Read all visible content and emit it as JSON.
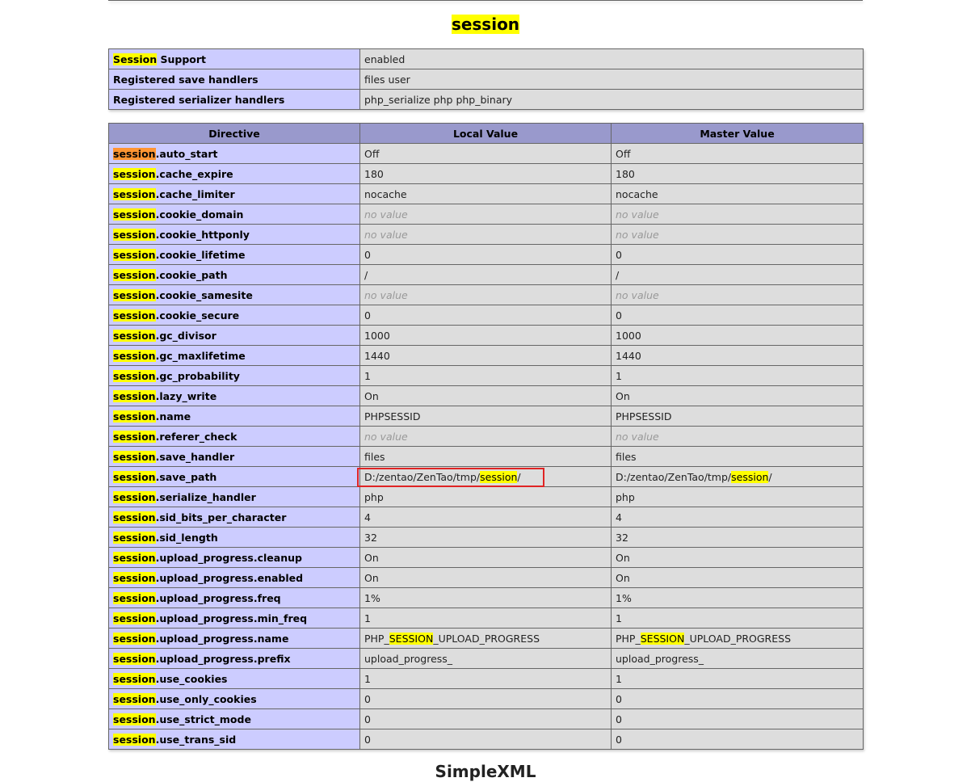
{
  "page": {
    "section_title": "session",
    "search_highlight": "session",
    "next_section_title": "SimpleXML"
  },
  "info_rows": [
    {
      "label_hl": "Session",
      "label_rest": " Support",
      "value": "enabled"
    },
    {
      "label_hl": "",
      "label_rest": "Registered save handlers",
      "value": "files user"
    },
    {
      "label_hl": "",
      "label_rest": "Registered serializer handlers",
      "value": "php_serialize php php_binary"
    }
  ],
  "directive_table": {
    "headers": [
      "Directive",
      "Local Value",
      "Master Value"
    ],
    "rows": [
      {
        "prefix": "session",
        "name": ".auto_start",
        "local": "Off",
        "master": "Off",
        "active": true
      },
      {
        "prefix": "session",
        "name": ".cache_expire",
        "local": "180",
        "master": "180"
      },
      {
        "prefix": "session",
        "name": ".cache_limiter",
        "local": "nocache",
        "master": "nocache"
      },
      {
        "prefix": "session",
        "name": ".cookie_domain",
        "local": "no value",
        "master": "no value",
        "novalue": true
      },
      {
        "prefix": "session",
        "name": ".cookie_httponly",
        "local": "no value",
        "master": "no value",
        "novalue": true
      },
      {
        "prefix": "session",
        "name": ".cookie_lifetime",
        "local": "0",
        "master": "0"
      },
      {
        "prefix": "session",
        "name": ".cookie_path",
        "local": "/",
        "master": "/"
      },
      {
        "prefix": "session",
        "name": ".cookie_samesite",
        "local": "no value",
        "master": "no value",
        "novalue": true
      },
      {
        "prefix": "session",
        "name": ".cookie_secure",
        "local": "0",
        "master": "0"
      },
      {
        "prefix": "session",
        "name": ".gc_divisor",
        "local": "1000",
        "master": "1000"
      },
      {
        "prefix": "session",
        "name": ".gc_maxlifetime",
        "local": "1440",
        "master": "1440"
      },
      {
        "prefix": "session",
        "name": ".gc_probability",
        "local": "1",
        "master": "1"
      },
      {
        "prefix": "session",
        "name": ".lazy_write",
        "local": "On",
        "master": "On"
      },
      {
        "prefix": "session",
        "name": ".name",
        "local": "PHPSESSID",
        "master": "PHPSESSID"
      },
      {
        "prefix": "session",
        "name": ".referer_check",
        "local": "no value",
        "master": "no value",
        "novalue": true
      },
      {
        "prefix": "session",
        "name": ".save_handler",
        "local": "files",
        "master": "files"
      },
      {
        "prefix": "session",
        "name": ".save_path",
        "local": [
          "D:/zentao/ZenTao/tmp/",
          "session",
          "/"
        ],
        "master": [
          "D:/zentao/ZenTao/tmp/",
          "session",
          "/"
        ]
      },
      {
        "prefix": "session",
        "name": ".serialize_handler",
        "local": "php",
        "master": "php"
      },
      {
        "prefix": "session",
        "name": ".sid_bits_per_character",
        "local": "4",
        "master": "4"
      },
      {
        "prefix": "session",
        "name": ".sid_length",
        "local": "32",
        "master": "32"
      },
      {
        "prefix": "session",
        "name": ".upload_progress.cleanup",
        "local": "On",
        "master": "On"
      },
      {
        "prefix": "session",
        "name": ".upload_progress.enabled",
        "local": "On",
        "master": "On"
      },
      {
        "prefix": "session",
        "name": ".upload_progress.freq",
        "local": "1%",
        "master": "1%"
      },
      {
        "prefix": "session",
        "name": ".upload_progress.min_freq",
        "local": "1",
        "master": "1"
      },
      {
        "prefix": "session",
        "name": ".upload_progress.name",
        "local": [
          "PHP_",
          "SESSION",
          "_UPLOAD_PROGRESS"
        ],
        "master": [
          "PHP_",
          "SESSION",
          "_UPLOAD_PROGRESS"
        ]
      },
      {
        "prefix": "session",
        "name": ".upload_progress.prefix",
        "local": "upload_progress_",
        "master": "upload_progress_"
      },
      {
        "prefix": "session",
        "name": ".use_cookies",
        "local": "1",
        "master": "1"
      },
      {
        "prefix": "session",
        "name": ".use_only_cookies",
        "local": "0",
        "master": "0"
      },
      {
        "prefix": "session",
        "name": ".use_strict_mode",
        "local": "0",
        "master": "0"
      },
      {
        "prefix": "session",
        "name": ".use_trans_sid",
        "local": "0",
        "master": "0"
      }
    ]
  },
  "colors": {
    "label_cell": "#ccccff",
    "value_cell": "#dddddd",
    "header_cell": "#9999cc",
    "search_highlight": "#ffff00",
    "active_highlight": "#ff9632",
    "annotation_box": "#e02424"
  }
}
